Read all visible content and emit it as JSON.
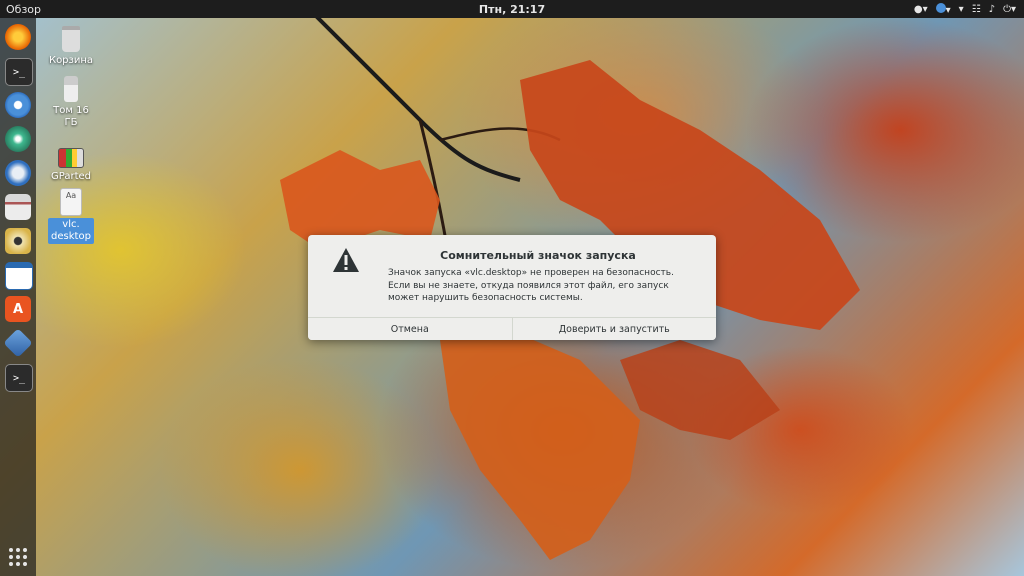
{
  "topbar": {
    "activities": "Обзор",
    "clock": "Птн, 21:17"
  },
  "dock": {
    "items": [
      {
        "name": "firefox-icon",
        "color": "#e66000"
      },
      {
        "name": "terminal-icon",
        "color": "#2b2b2b"
      },
      {
        "name": "chromium-icon",
        "color": "#4a90d9"
      },
      {
        "name": "atom-icon",
        "color": "#3fb88f"
      },
      {
        "name": "thunderbird-icon",
        "color": "#2f6fbf"
      },
      {
        "name": "files-icon",
        "color": "#8a8a8a"
      },
      {
        "name": "rhythmbox-icon",
        "color": "#d9b44a"
      },
      {
        "name": "writer-icon",
        "color": "#2a6ab1"
      },
      {
        "name": "software-center-icon",
        "color": "#e95420"
      },
      {
        "name": "virtualbox-icon",
        "color": "#2e5fa3"
      },
      {
        "name": "terminal-icon-2",
        "color": "#2b2b2b"
      }
    ]
  },
  "desktop": {
    "trash_label": "Корзина",
    "volume_label": "Том 16 ГБ",
    "gparted_label": "GParted",
    "vlc_label": "vlc.\ndesktop"
  },
  "dialog": {
    "title": "Сомнительный значок запуска",
    "message": "Значок запуска «vlc.desktop» не проверен на безопасность. Если вы не знаете, откуда появился этот файл, его запуск может нарушить безопасность системы.",
    "cancel_label": "Отмена",
    "trust_label": "Доверить и запустить"
  }
}
